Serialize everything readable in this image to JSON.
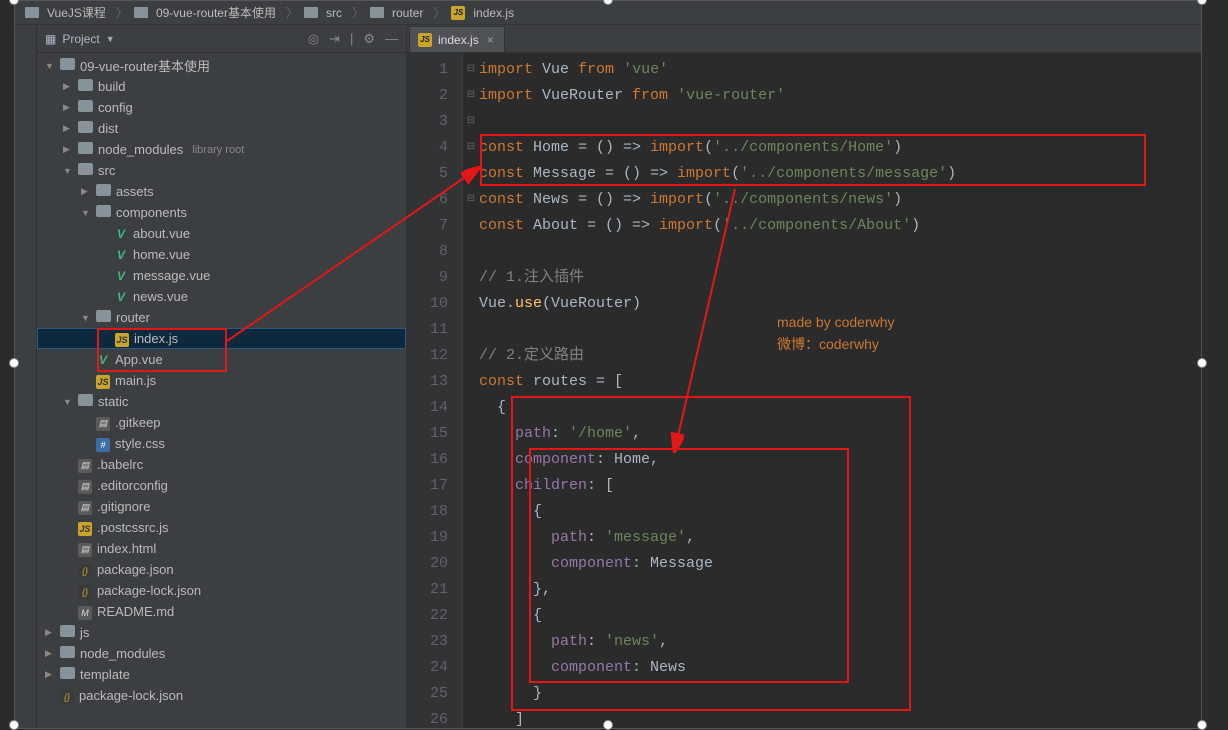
{
  "breadcrumb": {
    "items": [
      "VueJS课程",
      "09-vue-router基本使用",
      "src",
      "router",
      "index.js"
    ]
  },
  "project": {
    "title": "Project",
    "tree": [
      {
        "indent": 0,
        "arrow": "down",
        "icon": "folder",
        "label": "09-vue-router基本使用"
      },
      {
        "indent": 1,
        "arrow": "right",
        "icon": "folder",
        "label": "build"
      },
      {
        "indent": 1,
        "arrow": "right",
        "icon": "folder",
        "label": "config"
      },
      {
        "indent": 1,
        "arrow": "right",
        "icon": "folder",
        "label": "dist"
      },
      {
        "indent": 1,
        "arrow": "right",
        "icon": "folder",
        "label": "node_modules",
        "after": "library root"
      },
      {
        "indent": 1,
        "arrow": "down",
        "icon": "folder",
        "label": "src"
      },
      {
        "indent": 2,
        "arrow": "right",
        "icon": "folder",
        "label": "assets"
      },
      {
        "indent": 2,
        "arrow": "down",
        "icon": "folder",
        "label": "components"
      },
      {
        "indent": 3,
        "arrow": "none",
        "icon": "vue",
        "label": "about.vue"
      },
      {
        "indent": 3,
        "arrow": "none",
        "icon": "vue",
        "label": "home.vue"
      },
      {
        "indent": 3,
        "arrow": "none",
        "icon": "vue",
        "label": "message.vue"
      },
      {
        "indent": 3,
        "arrow": "none",
        "icon": "vue",
        "label": "news.vue"
      },
      {
        "indent": 2,
        "arrow": "down",
        "icon": "folder",
        "label": "router"
      },
      {
        "indent": 3,
        "arrow": "none",
        "icon": "js",
        "label": "index.js",
        "selected": true
      },
      {
        "indent": 2,
        "arrow": "none",
        "icon": "vue",
        "label": "App.vue"
      },
      {
        "indent": 2,
        "arrow": "none",
        "icon": "js",
        "label": "main.js"
      },
      {
        "indent": 1,
        "arrow": "down",
        "icon": "folder",
        "label": "static"
      },
      {
        "indent": 2,
        "arrow": "none",
        "icon": "file",
        "label": ".gitkeep"
      },
      {
        "indent": 2,
        "arrow": "none",
        "icon": "css",
        "label": "style.css"
      },
      {
        "indent": 1,
        "arrow": "none",
        "icon": "file",
        "label": ".babelrc"
      },
      {
        "indent": 1,
        "arrow": "none",
        "icon": "file",
        "label": ".editorconfig"
      },
      {
        "indent": 1,
        "arrow": "none",
        "icon": "file",
        "label": ".gitignore"
      },
      {
        "indent": 1,
        "arrow": "none",
        "icon": "js",
        "label": ".postcssrc.js"
      },
      {
        "indent": 1,
        "arrow": "none",
        "icon": "file",
        "label": "index.html"
      },
      {
        "indent": 1,
        "arrow": "none",
        "icon": "json",
        "label": "package.json"
      },
      {
        "indent": 1,
        "arrow": "none",
        "icon": "json",
        "label": "package-lock.json"
      },
      {
        "indent": 1,
        "arrow": "none",
        "icon": "md",
        "label": "README.md"
      },
      {
        "indent": 0,
        "arrow": "right",
        "icon": "folder",
        "label": "js"
      },
      {
        "indent": 0,
        "arrow": "right",
        "icon": "folder",
        "label": "node_modules"
      },
      {
        "indent": 0,
        "arrow": "right",
        "icon": "folder",
        "label": "template"
      },
      {
        "indent": 0,
        "arrow": "none",
        "icon": "json",
        "label": "package-lock.json"
      }
    ]
  },
  "tab": {
    "label": "index.js"
  },
  "watermark": {
    "l1": "made by coderwhy",
    "l2": "微博：coderwhy"
  },
  "code_lines": 26,
  "code": {
    "l1": {
      "pre": "",
      "html": "<span class='kw'>import</span> Vue <span class='kw'>from</span> <span class='str'>'vue'</span>"
    },
    "l2": {
      "pre": "",
      "html": "<span class='kw'>import</span> VueRouter <span class='kw'>from</span> <span class='str'>'vue-router'</span>"
    },
    "l3": {
      "pre": "",
      "html": ""
    },
    "l4": {
      "pre": "",
      "html": "<span class='kw'>const</span> Home = () =&gt; <span class='kw'>import</span>(<span class='str'>'../components/Home'</span>)"
    },
    "l5": {
      "pre": "",
      "html": "<span class='kw'>const</span> Message = () =&gt; <span class='kw'>import</span>(<span class='str'>'../components/message'</span>)"
    },
    "l6": {
      "pre": "",
      "html": "<span class='kw'>const</span> News = () =&gt; <span class='kw'>import</span>(<span class='str'>'../components/news'</span>)"
    },
    "l7": {
      "pre": "",
      "html": "<span class='kw'>const</span> About = () =&gt; <span class='kw'>import</span>(<span class='str'>'../components/About'</span>)"
    },
    "l8": {
      "pre": "",
      "html": ""
    },
    "l9": {
      "pre": "",
      "html": "<span class='cm'>// 1.注入插件</span>"
    },
    "l10": {
      "pre": "",
      "html": "Vue.<span class='fn'>use</span>(VueRouter)"
    },
    "l11": {
      "pre": "",
      "html": ""
    },
    "l12": {
      "pre": "",
      "html": "<span class='cm'>// 2.定义路由</span>"
    },
    "l13": {
      "pre": "",
      "html": "<span class='kw'>const</span> routes = ["
    },
    "l14": {
      "pre": "  ",
      "html": "{"
    },
    "l15": {
      "pre": "    ",
      "html": "<span class='pr'>path</span>: <span class='str'>'/home'</span>,"
    },
    "l16": {
      "pre": "    ",
      "html": "<span class='pr'>component</span>: Home,"
    },
    "l17": {
      "pre": "    ",
      "html": "<span class='pr'>children</span>: ["
    },
    "l18": {
      "pre": "      ",
      "html": "{"
    },
    "l19": {
      "pre": "        ",
      "html": "<span class='pr'>path</span>: <span class='str'>'message'</span>,"
    },
    "l20": {
      "pre": "        ",
      "html": "<span class='pr'>component</span>: Message"
    },
    "l21": {
      "pre": "      ",
      "html": "},"
    },
    "l22": {
      "pre": "      ",
      "html": "{"
    },
    "l23": {
      "pre": "        ",
      "html": "<span class='pr'>path</span>: <span class='str'>'news'</span>,"
    },
    "l24": {
      "pre": "        ",
      "html": "<span class='pr'>component</span>: News"
    },
    "l25": {
      "pre": "      ",
      "html": "}"
    },
    "l26": {
      "pre": "    ",
      "html": "]"
    }
  }
}
